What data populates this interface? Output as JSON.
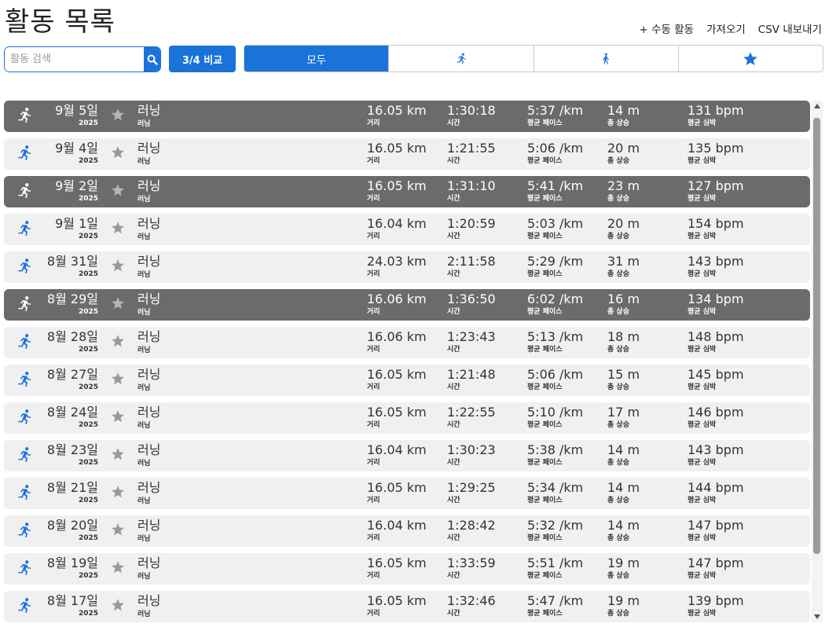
{
  "page": {
    "title": "활동 목록"
  },
  "header": {
    "actions": {
      "manual": "+ 수동 활동",
      "import": "가져오기",
      "export": "CSV 내보내기"
    }
  },
  "search": {
    "placeholder": "활동 검색",
    "value": ""
  },
  "compare": {
    "label": "3/4 비교"
  },
  "filters": {
    "all_label": "모두",
    "tab_icons": [
      "running-icon",
      "walking-icon",
      "star-icon"
    ],
    "active_index": 0
  },
  "colors": {
    "accent": "#1a73d9",
    "selected_row": "#6b6b6b",
    "row": "#f0f0f0"
  },
  "labels": {
    "distance": "거리",
    "time": "시간",
    "pace": "평균 페이스",
    "elevation": "총 상승",
    "heart_rate": "평균 심박"
  },
  "activities": [
    {
      "date": "9월 5일",
      "year": "2025",
      "name": "러닝",
      "type": "러닝",
      "distance": "16.05 km",
      "time": "1:30:18",
      "pace": "5:37 /km",
      "elevation": "14 m",
      "hr": "131 bpm",
      "selected": true
    },
    {
      "date": "9월 4일",
      "year": "2025",
      "name": "러닝",
      "type": "러닝",
      "distance": "16.05 km",
      "time": "1:21:55",
      "pace": "5:06 /km",
      "elevation": "20 m",
      "hr": "135 bpm",
      "selected": false
    },
    {
      "date": "9월 2일",
      "year": "2025",
      "name": "러닝",
      "type": "러닝",
      "distance": "16.05 km",
      "time": "1:31:10",
      "pace": "5:41 /km",
      "elevation": "23 m",
      "hr": "127 bpm",
      "selected": true
    },
    {
      "date": "9월 1일",
      "year": "2025",
      "name": "러닝",
      "type": "러닝",
      "distance": "16.04 km",
      "time": "1:20:59",
      "pace": "5:03 /km",
      "elevation": "20 m",
      "hr": "154 bpm",
      "selected": false
    },
    {
      "date": "8월 31일",
      "year": "2025",
      "name": "러닝",
      "type": "러닝",
      "distance": "24.03 km",
      "time": "2:11:58",
      "pace": "5:29 /km",
      "elevation": "31 m",
      "hr": "143 bpm",
      "selected": false
    },
    {
      "date": "8월 29일",
      "year": "2025",
      "name": "러닝",
      "type": "러닝",
      "distance": "16.06 km",
      "time": "1:36:50",
      "pace": "6:02 /km",
      "elevation": "16 m",
      "hr": "134 bpm",
      "selected": true
    },
    {
      "date": "8월 28일",
      "year": "2025",
      "name": "러닝",
      "type": "러닝",
      "distance": "16.06 km",
      "time": "1:23:43",
      "pace": "5:13 /km",
      "elevation": "18 m",
      "hr": "148 bpm",
      "selected": false
    },
    {
      "date": "8월 27일",
      "year": "2025",
      "name": "러닝",
      "type": "러닝",
      "distance": "16.05 km",
      "time": "1:21:48",
      "pace": "5:06 /km",
      "elevation": "15 m",
      "hr": "145 bpm",
      "selected": false
    },
    {
      "date": "8월 24일",
      "year": "2025",
      "name": "러닝",
      "type": "러닝",
      "distance": "16.05 km",
      "time": "1:22:55",
      "pace": "5:10 /km",
      "elevation": "17 m",
      "hr": "146 bpm",
      "selected": false
    },
    {
      "date": "8월 23일",
      "year": "2025",
      "name": "러닝",
      "type": "러닝",
      "distance": "16.04 km",
      "time": "1:30:23",
      "pace": "5:38 /km",
      "elevation": "14 m",
      "hr": "143 bpm",
      "selected": false
    },
    {
      "date": "8월 21일",
      "year": "2025",
      "name": "러닝",
      "type": "러닝",
      "distance": "16.05 km",
      "time": "1:29:25",
      "pace": "5:34 /km",
      "elevation": "14 m",
      "hr": "144 bpm",
      "selected": false
    },
    {
      "date": "8월 20일",
      "year": "2025",
      "name": "러닝",
      "type": "러닝",
      "distance": "16.04 km",
      "time": "1:28:42",
      "pace": "5:32 /km",
      "elevation": "14 m",
      "hr": "147 bpm",
      "selected": false
    },
    {
      "date": "8월 19일",
      "year": "2025",
      "name": "러닝",
      "type": "러닝",
      "distance": "16.05 km",
      "time": "1:33:59",
      "pace": "5:51 /km",
      "elevation": "19 m",
      "hr": "147 bpm",
      "selected": false
    },
    {
      "date": "8월 17일",
      "year": "2025",
      "name": "러닝",
      "type": "러닝",
      "distance": "16.05 km",
      "time": "1:32:46",
      "pace": "5:47 /km",
      "elevation": "19 m",
      "hr": "139 bpm",
      "selected": false
    }
  ]
}
